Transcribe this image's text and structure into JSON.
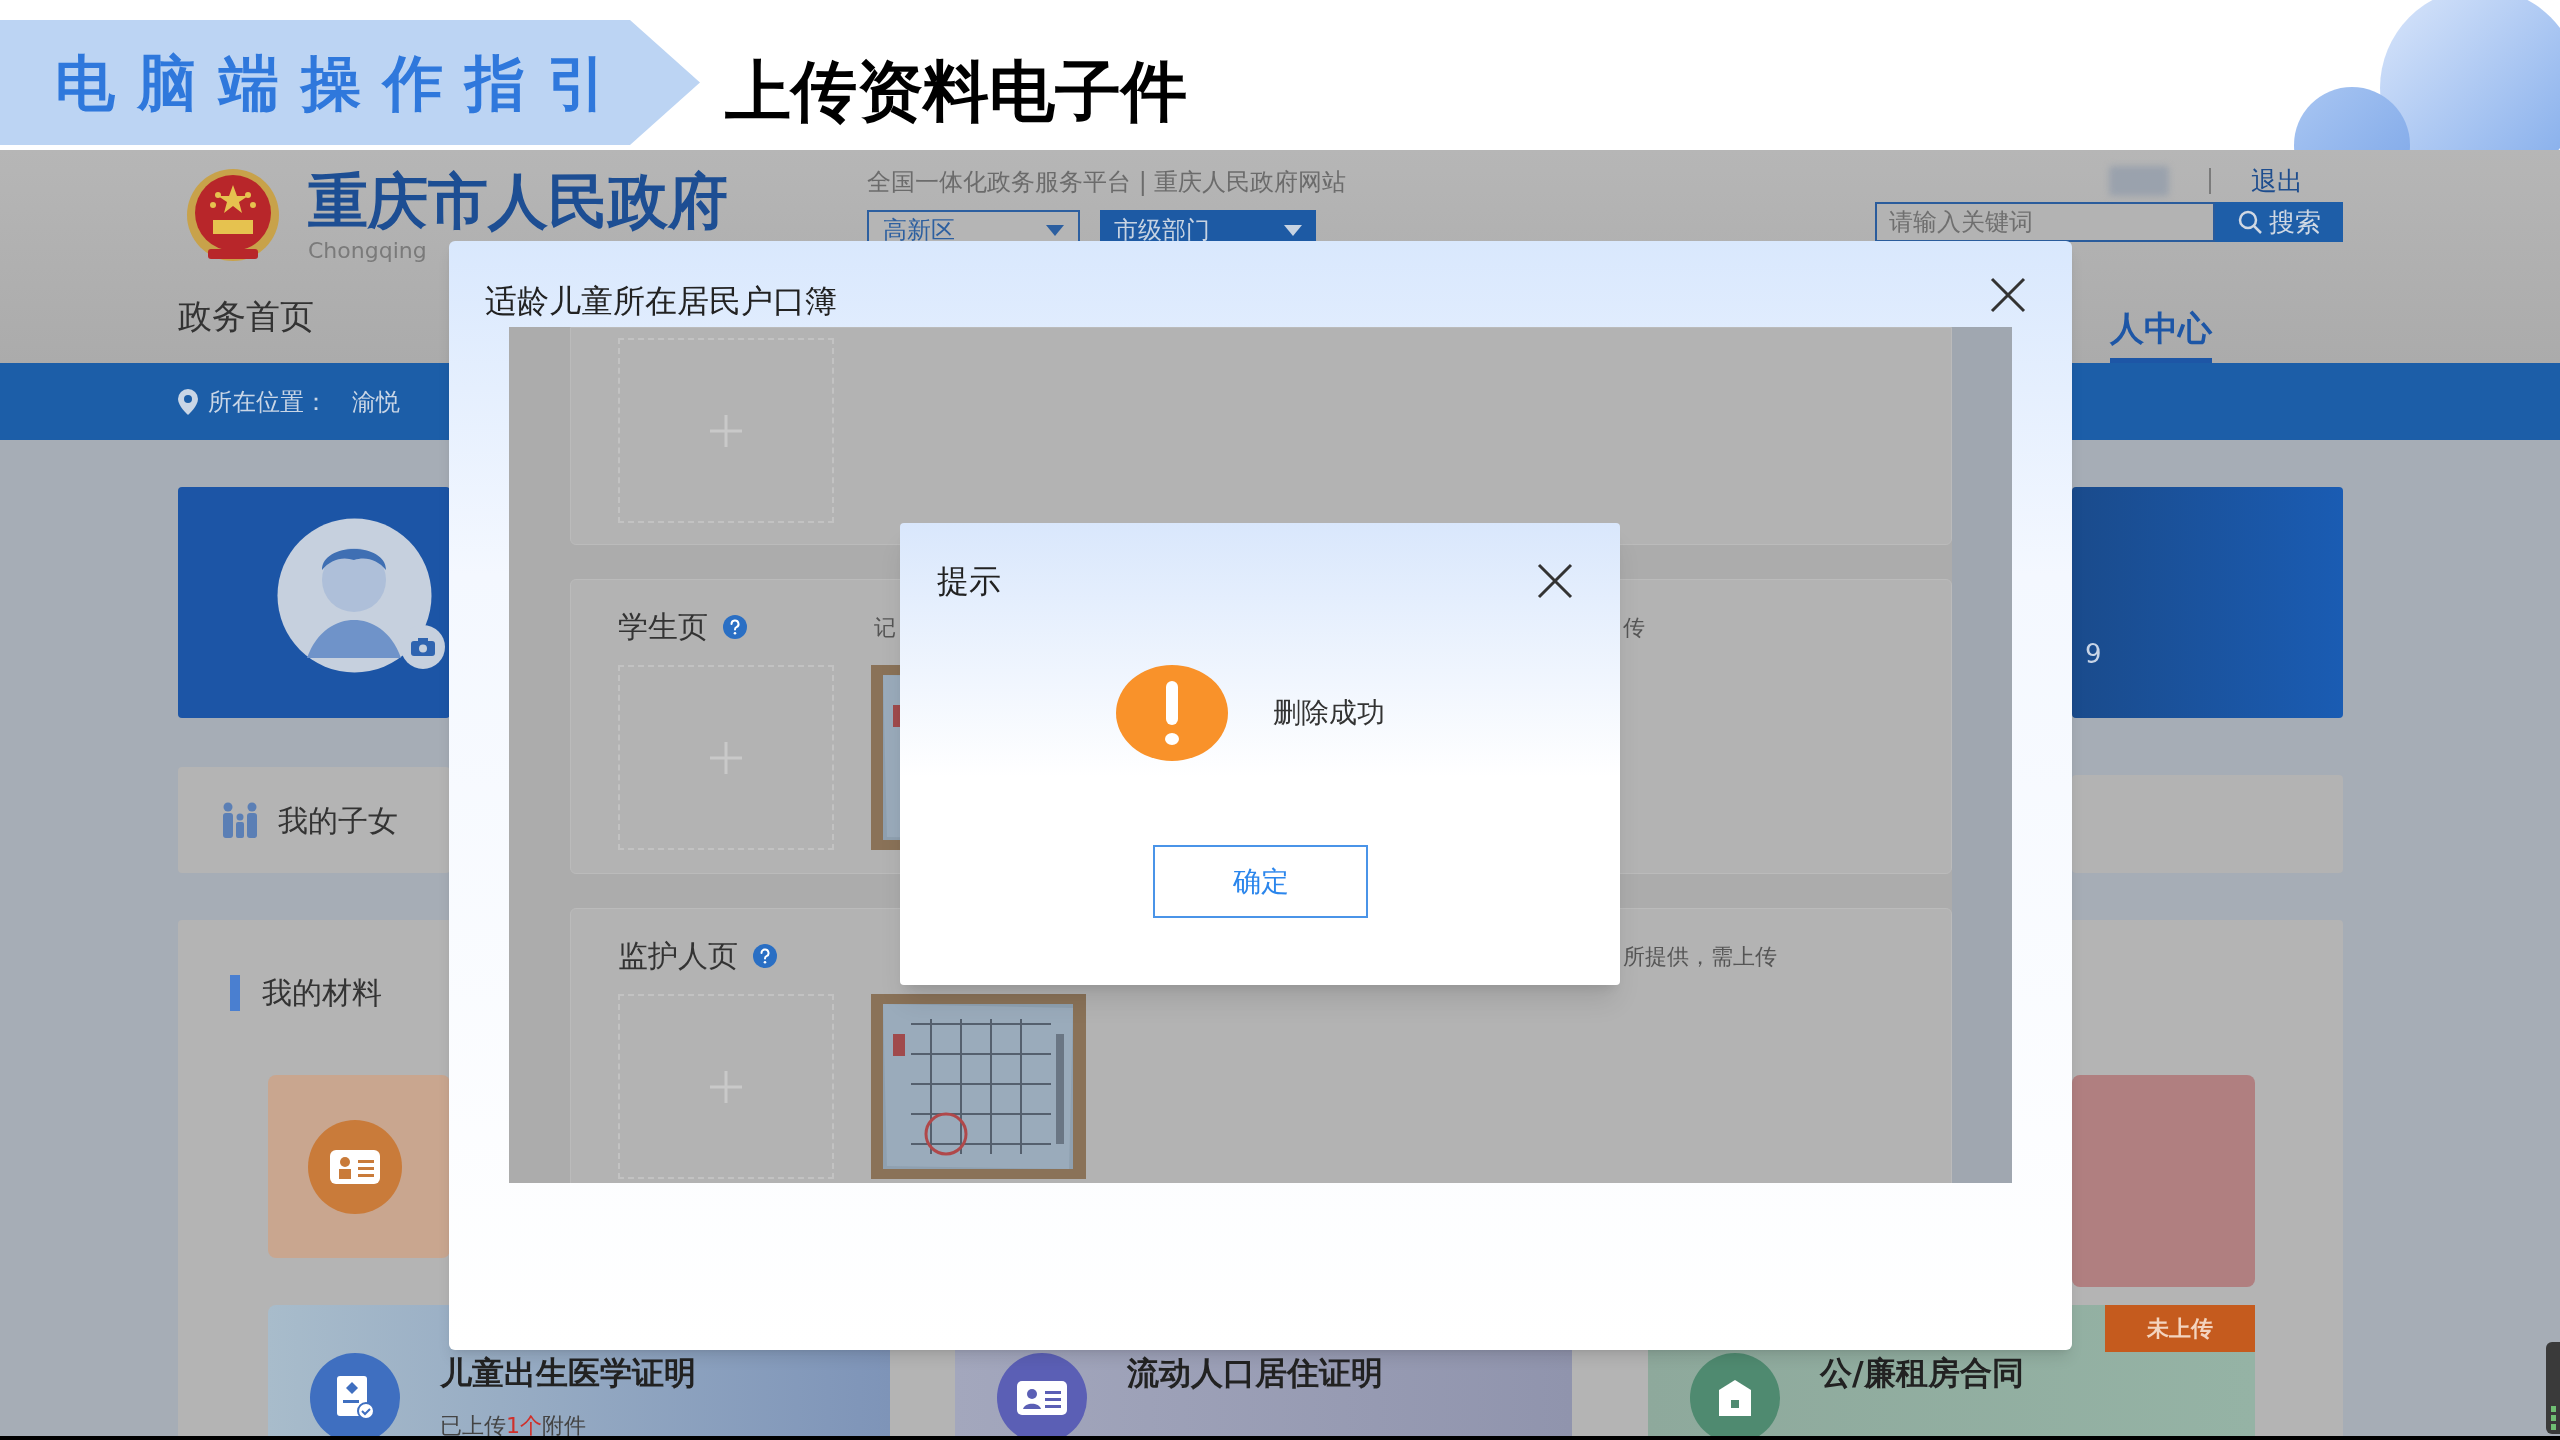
{
  "slide": {
    "section_banner": "电脑端操作指引",
    "title": "上传资料电子件"
  },
  "site": {
    "name": "重庆市人民政府",
    "name_latin": "Chongqing",
    "tagline": "全国一体化政务服务平台 | 重庆人民政府网站",
    "region_select": "高新区",
    "department_select": "市级部门",
    "logout": "退出",
    "search": {
      "placeholder": "请输入关键词",
      "button": "搜索"
    },
    "nav": [
      {
        "label": "政务首页",
        "selected": false
      },
      {
        "label": "人中心",
        "selected": true
      }
    ],
    "breadcrumb": {
      "label": "所在位置：",
      "path": "渝悦"
    },
    "profile_card": {
      "number_fragment": "9"
    },
    "children_link": "我的子女",
    "materials": {
      "title": "我的材料",
      "color_tiles": [
        {
          "color": "#c9a68f"
        },
        {
          "color": "#b07f80"
        }
      ],
      "tiles": [
        {
          "title": "儿童出生医学证明",
          "color": "#3f6fc0",
          "status": {
            "prefix": "已上传",
            "count": "1个",
            "suffix": "附件"
          }
        },
        {
          "title": "流动人口居住证明",
          "color": "#5b5fb5"
        },
        {
          "title": "公/廉租房合同",
          "color": "#4f8a70",
          "badge": "未上传"
        }
      ]
    }
  },
  "upload_dialog": {
    "title": "适龄儿童所在居民户口簿",
    "sections": [
      {
        "photo": false
      },
      {
        "title": "学生页",
        "hint_left": "记",
        "hint_right": "传",
        "photo": true
      },
      {
        "title": "监护人页",
        "hint_right": "所提供，需上传",
        "photo": true
      }
    ]
  },
  "alert": {
    "title": "提示",
    "message": "删除成功",
    "confirm": "确定"
  }
}
